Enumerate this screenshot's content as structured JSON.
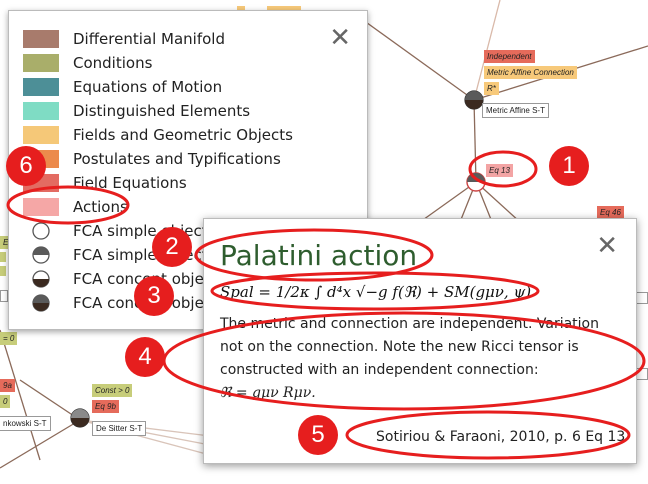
{
  "graph": {
    "nodes": [
      {
        "label": "Independent",
        "color": "red"
      },
      {
        "label": "Metric Affine Connection",
        "color": "orange"
      },
      {
        "label": "R*",
        "color": "orange"
      },
      {
        "label": "Metric Affine S-T",
        "color": "plain"
      },
      {
        "label": "Eq 13",
        "color": "pink"
      },
      {
        "label": "Eq 46",
        "color": "red"
      },
      {
        "label": "Const > 0",
        "color": "green"
      },
      {
        "label": "Eq 9b",
        "color": "red"
      },
      {
        "label": "De Sitter S-T",
        "color": "plain"
      },
      {
        "label": "nkowski S-T",
        "color": "plain"
      },
      {
        "label": "9a",
        "color": "red"
      },
      {
        "label": "0",
        "color": "green"
      },
      {
        "label": "Eq",
        "color": "green"
      },
      {
        "label": "= 0",
        "color": "green"
      }
    ]
  },
  "legend": {
    "close_label": "✕",
    "items": [
      {
        "label": "Differential Manifold",
        "color": "#a87b6c"
      },
      {
        "label": "Conditions",
        "color": "#a9ae6a"
      },
      {
        "label": "Equations of Motion",
        "color": "#4d8f97"
      },
      {
        "label": "Distinguished Elements",
        "color": "#7fdcc4"
      },
      {
        "label": "Fields and Geometric Objects",
        "color": "#f5c878"
      },
      {
        "label": "Postulates and Typifications",
        "color": "#ec8a4c"
      },
      {
        "label": "Field Equations",
        "color": "#e36b62"
      },
      {
        "label": "Actions",
        "color": "#f5a7a6"
      },
      {
        "label": "FCA simple object"
      },
      {
        "label": "FCA simple object"
      },
      {
        "label": "FCA concept object"
      },
      {
        "label": "FCA concept object"
      }
    ]
  },
  "popup": {
    "close_label": "✕",
    "title": "Palatini action",
    "formula": "Spal = 1/2κ ∫ d⁴x √−g f(ℜ) + SM(gμν, ψ)",
    "desc_line1": "The metric and connection are independent. Variation",
    "desc_line2": "not on the connection. Note the new Ricci tensor is",
    "desc_line3": "constructed with an independent connection:",
    "desc_line4": "ℜ = gμν Rμν.",
    "citation": "Sotiriou & Faraoni, 2010, p. 6 Eq 13"
  },
  "annotations": {
    "color": "#e61e1e",
    "numbers": [
      "1",
      "2",
      "3",
      "4",
      "5",
      "6"
    ]
  }
}
